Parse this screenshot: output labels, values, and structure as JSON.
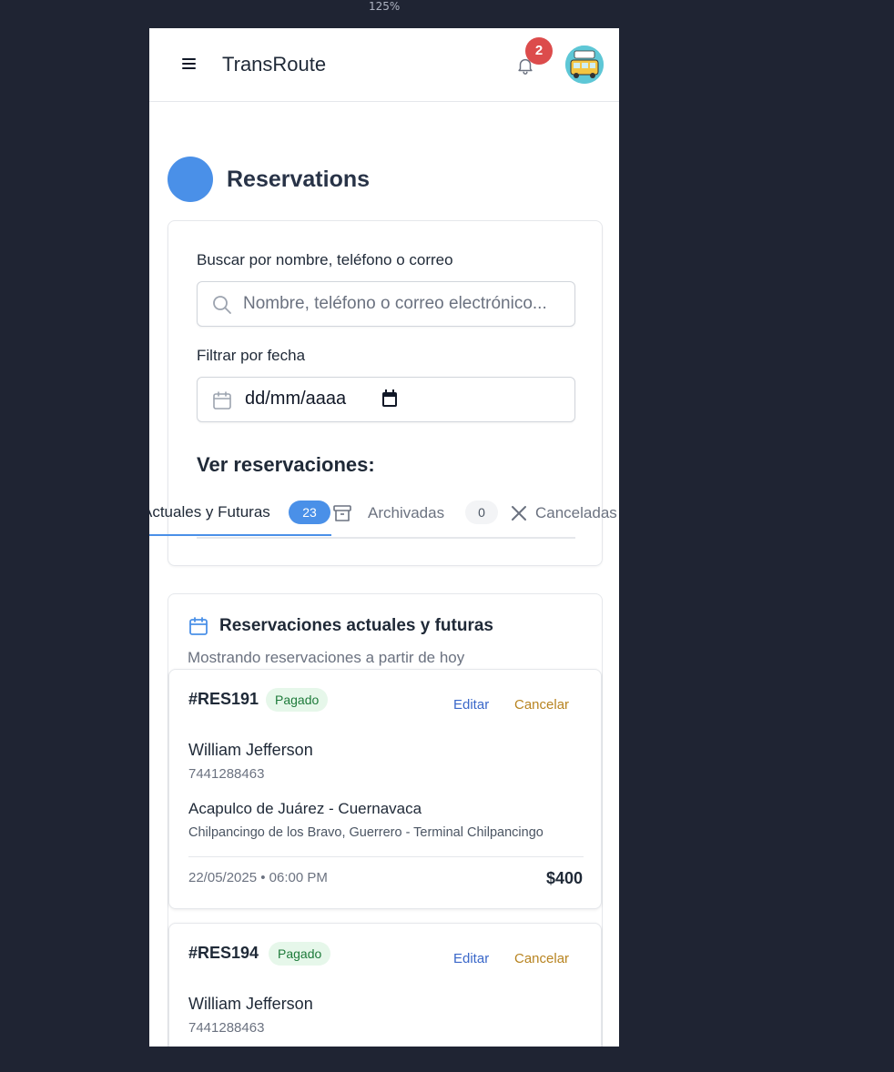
{
  "browser": {
    "zoom": "125%"
  },
  "header": {
    "app_title": "TransRoute",
    "notification_count": "2"
  },
  "page": {
    "title": "Reservations"
  },
  "filters": {
    "search_label": "Buscar por nombre, teléfono o correo",
    "search_placeholder": "Nombre, teléfono o correo electrónico...",
    "date_label": "Filtrar por fecha",
    "date_value": "dd/mm/aaaa",
    "view_title": "Ver reservaciones:"
  },
  "tabs": [
    {
      "label": "Actuales y Futuras",
      "count": "23",
      "active": true
    },
    {
      "label": "Archivadas",
      "count": "0",
      "active": false
    },
    {
      "label": "Canceladas",
      "count": "",
      "active": false
    }
  ],
  "list": {
    "title": "Reservaciones actuales y futuras",
    "subtitle": "Mostrando reservaciones a partir de hoy",
    "edit_label": "Editar",
    "cancel_label": "Cancelar",
    "items": [
      {
        "id": "#RES191",
        "status": "Pagado",
        "name": "William Jefferson",
        "phone": "7441288463",
        "route": "Acapulco de Juárez - Cuernavaca",
        "route_detail": "Chilpancingo de los Bravo, Guerrero - Terminal Chilpancingo",
        "datetime": "22/05/2025 • 06:00 PM",
        "price": "$400"
      },
      {
        "id": "#RES194",
        "status": "Pagado",
        "name": "William Jefferson",
        "phone": "7441288463"
      }
    ]
  },
  "colors": {
    "background": "#1f2433",
    "accent": "#4a90e8",
    "badge": "#dc4c4c",
    "paid_bg": "#e6f7ea",
    "paid_text": "#1d7a3a",
    "edit": "#3a67c9",
    "cancel": "#b88421"
  }
}
